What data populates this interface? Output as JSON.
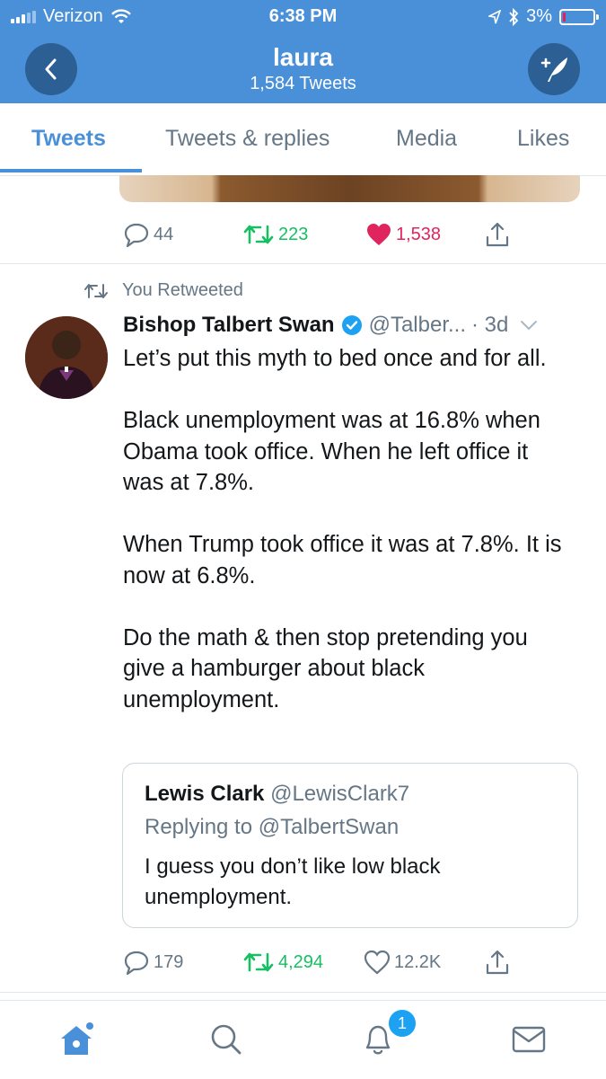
{
  "status_bar": {
    "carrier": "Verizon",
    "time": "6:38 PM",
    "battery": "3%"
  },
  "header": {
    "name": "laura",
    "tweet_count": "1,584 Tweets"
  },
  "tabs": [
    {
      "label": "Tweets",
      "active": true
    },
    {
      "label": "Tweets & replies",
      "active": false
    },
    {
      "label": "Media",
      "active": false
    },
    {
      "label": "Likes",
      "active": false
    }
  ],
  "prev_tweet": {
    "replies": "44",
    "retweets": "223",
    "likes": "1,538",
    "liked": true
  },
  "tweet": {
    "retweeted_by": "You Retweeted",
    "author_name": "Bishop Talbert Swan",
    "handle": "@Talber...",
    "time": "· 3d",
    "text": "Let’s put this myth to bed once and for all.\n\nBlack unemployment was at 16.8% when Obama took office. When he left office it was at 7.8%.\n\nWhen Trump took office it was at 7.8%. It is now at 6.8%.\n\nDo the math & then stop pretending you give a hamburger about black unemployment.",
    "quote": {
      "author_name": "Lewis Clark",
      "handle": "@LewisClark7",
      "replying_to": "Replying to @TalbertSwan",
      "text": "I guess you don’t like low black unemployment."
    },
    "replies": "179",
    "retweets": "4,294",
    "likes": "12.2K"
  },
  "bottom_nav": {
    "notifications_badge": "1"
  },
  "colors": {
    "brand": "#4a90d9",
    "retweet_green": "#17bf63",
    "like_red": "#e0245e",
    "muted": "#657786"
  }
}
